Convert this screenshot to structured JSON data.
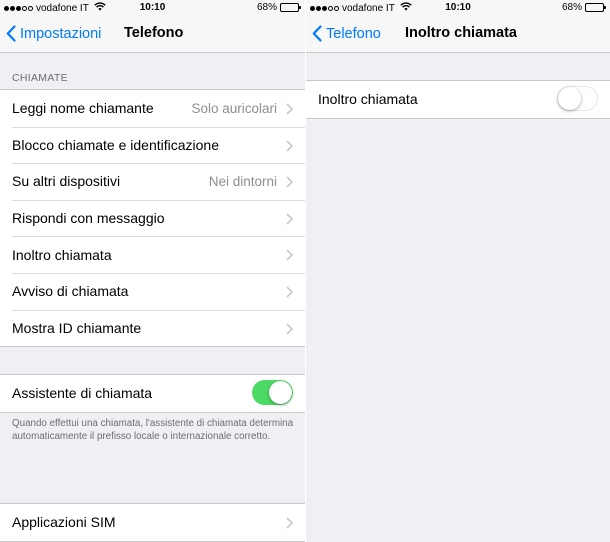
{
  "left": {
    "status": {
      "carrier": "vodafone IT",
      "time": "10:10",
      "battery": "68%",
      "battery_level": 0.68
    },
    "nav": {
      "back_label": "Impostazioni",
      "title": "Telefono"
    },
    "section_header": "CHIAMATE",
    "rows": [
      {
        "label": "Leggi nome chiamante",
        "value": "Solo auricolari"
      },
      {
        "label": "Blocco chiamate e identificazione",
        "value": ""
      },
      {
        "label": "Su altri dispositivi",
        "value": "Nei dintorni"
      },
      {
        "label": "Rispondi con messaggio",
        "value": ""
      },
      {
        "label": "Inoltro chiamata",
        "value": ""
      },
      {
        "label": "Avviso di chiamata",
        "value": ""
      },
      {
        "label": "Mostra ID chiamante",
        "value": ""
      }
    ],
    "assistant": {
      "label": "Assistente di chiamata",
      "enabled": true
    },
    "assistant_footer": "Quando effettui una chiamata, l'assistente di chiamata determina automaticamente il prefisso locale o internazionale corretto.",
    "sim": {
      "label": "Applicazioni SIM"
    }
  },
  "right": {
    "status": {
      "carrier": "vodafone IT",
      "time": "10:10",
      "battery": "68%",
      "battery_level": 0.68
    },
    "nav": {
      "back_label": "Telefono",
      "title": "Inoltro chiamata"
    },
    "forwarding": {
      "label": "Inoltro chiamata",
      "enabled": false
    }
  },
  "colors": {
    "accent": "#007aff",
    "toggle_on": "#4cd964",
    "background": "#efeff4",
    "secondary_text": "#8e8e93"
  },
  "icons": [
    "signal-dots-icon",
    "wifi-icon",
    "battery-icon",
    "back-chevron-icon",
    "disclosure-chevron-icon"
  ]
}
